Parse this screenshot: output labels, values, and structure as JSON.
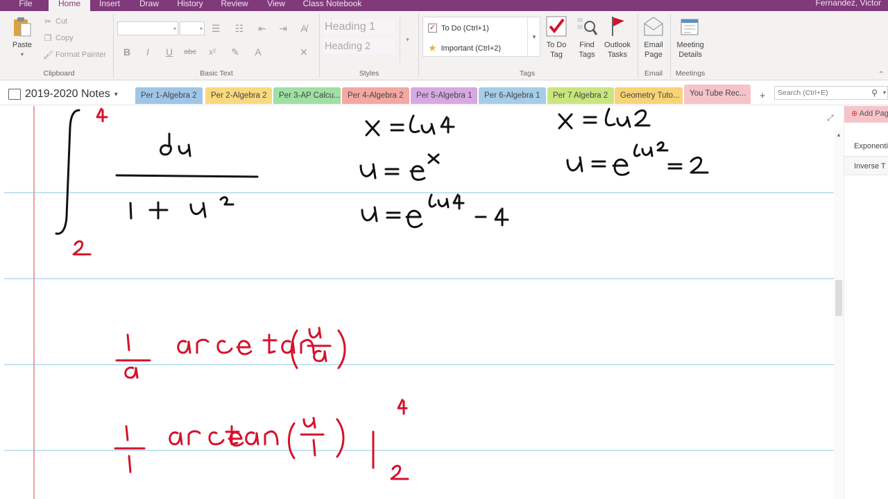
{
  "menubar": {
    "tabs": [
      {
        "label": "File"
      },
      {
        "label": "Home",
        "active": true
      },
      {
        "label": "Insert"
      },
      {
        "label": "Draw"
      },
      {
        "label": "History"
      },
      {
        "label": "Review"
      },
      {
        "label": "View"
      },
      {
        "label": "Class Notebook"
      }
    ],
    "user_name": "Fernandez, Victor"
  },
  "ribbon": {
    "clipboard": {
      "paste_label": "Paste",
      "cut_label": "Cut",
      "copy_label": "Copy",
      "format_painter_label": "Format Painter",
      "group_label": "Clipboard"
    },
    "basic_text": {
      "group_label": "Basic Text"
    },
    "styles": {
      "heading1": "Heading 1",
      "heading2": "Heading 2",
      "group_label": "Styles"
    },
    "tags": {
      "todo_label": "To Do (Ctrl+1)",
      "important_label": "Important (Ctrl+2)",
      "todo_tag_label": "To Do Tag",
      "find_tags_label": "Find Tags",
      "outlook_tasks_label": "Outlook Tasks",
      "group_label": "Tags"
    },
    "email": {
      "email_page_label": "Email Page",
      "group_label": "Email"
    },
    "meetings": {
      "meeting_details_label": "Meeting Details",
      "group_label": "Meetings"
    }
  },
  "notebook": {
    "name": "2019-2020 Notes",
    "sections": [
      {
        "label": "Per 1-Algebra 2",
        "color": "#9fc5e8"
      },
      {
        "label": "Per 2-Algebra 2",
        "color": "#f9d97e"
      },
      {
        "label": "Per 3-AP Calcu...",
        "color": "#9fe0a4"
      },
      {
        "label": "Per 4-Algebra 2",
        "color": "#f4a8a2"
      },
      {
        "label": "Per 5-Algebra 1",
        "color": "#d7a9e3"
      },
      {
        "label": "Per 6-Algebra 1",
        "color": "#a6cde8"
      },
      {
        "label": "Per 7 Algebra 2",
        "color": "#c9e67e"
      },
      {
        "label": "Geometry Tuto...",
        "color": "#f8d477"
      },
      {
        "label": "You Tube Rec...",
        "color": "#f5c4c9",
        "active": true
      }
    ],
    "add_section_label": "+",
    "search_placeholder": "Search (Ctrl+E)"
  },
  "pages_pane": {
    "add_page_label": "Add Page",
    "pages": [
      {
        "label": "Exponential"
      },
      {
        "label": "Inverse T"
      }
    ]
  },
  "ink": {
    "integral_upper": "4",
    "integral_lower": "2",
    "numerator": "du",
    "denominator": "1 + u²",
    "col2": [
      "x = ln 4",
      "u = eˣ",
      "u = e^ln4 = 4"
    ],
    "col3": [
      "x = ln 2",
      "u = e^ln2 = 2"
    ],
    "step1": "1/a arctan (u/a)",
    "step2": "1/1 arctan (u/1) | from 2 to 4"
  },
  "colors": {
    "brand": "#80397b",
    "ink_black": "#111111",
    "ink_red": "#d3122b",
    "rule_line": "#c3e3f4",
    "margin_line": "#e8a0a6"
  }
}
